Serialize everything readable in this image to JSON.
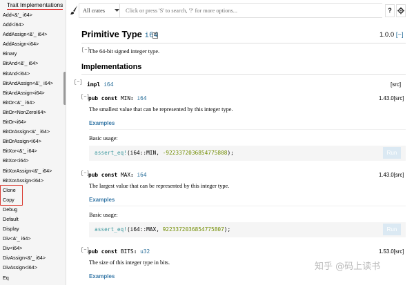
{
  "sidebar": {
    "title": "Trait Implementations",
    "items": [
      "Add<&'_ i64>",
      "Add<i64>",
      "AddAssign<&'_ i64>",
      "AddAssign<i64>",
      "Binary",
      "BitAnd<&'_ i64>",
      "BitAnd<i64>",
      "BitAndAssign<&'_ i64>",
      "BitAndAssign<i64>",
      "BitOr<&'_ i64>",
      "BitOr<NonZeroI64>",
      "BitOr<i64>",
      "BitOrAssign<&'_ i64>",
      "BitOrAssign<i64>",
      "BitXor<&'_ i64>",
      "BitXor<i64>",
      "BitXorAssign<&'_ i64>",
      "BitXorAssign<i64>",
      "Clone",
      "Copy",
      "Debug",
      "Default",
      "Display",
      "Div<&'_ i64>",
      "Div<i64>",
      "DivAssign<&'_ i64>",
      "DivAssign<i64>",
      "Eq"
    ]
  },
  "search": {
    "crate_select": "All crates",
    "placeholder": "Click or press 'S' to search, '?' for more options...",
    "help_label": "?"
  },
  "main": {
    "title_prefix": "Primitive Type",
    "title_type": "i64",
    "version": "1.0.0",
    "version_bracket": "[−]",
    "desc_toggle": "[−]",
    "description": "The 64-bit signed integer type.",
    "implementations_heading": "Implementations",
    "impl_toggle": "[−]",
    "impl_keyword": "impl",
    "impl_type": "i64",
    "impl_src": "[src]",
    "items": [
      {
        "toggle": "[−]",
        "sig_prefix": "pub const",
        "name": "MIN",
        "type": "i64",
        "version": "1.43.0[src]",
        "doc": "The smallest value that can be represented by this integer type.",
        "examples": "Examples",
        "basic": "Basic usage:",
        "code_macro": "assert_eq!",
        "code_mid": "(i64::MIN, ",
        "code_num": "-9223372036854775808",
        "code_end": ");",
        "run": "Run"
      },
      {
        "toggle": "[−]",
        "sig_prefix": "pub const",
        "name": "MAX",
        "type": "i64",
        "version": "1.43.0[src]",
        "doc": "The largest value that can be represented by this integer type.",
        "examples": "Examples",
        "basic": "Basic usage:",
        "code_macro": "assert_eq!",
        "code_mid": "(i64::MAX, ",
        "code_num": "9223372036854775807",
        "code_end": ");",
        "run": "Run"
      },
      {
        "toggle": "[−]",
        "sig_prefix": "pub const",
        "name": "BITS",
        "type": "u32",
        "version": "1.53.0[src]",
        "doc": "The size of this integer type in bits.",
        "examples": "Examples"
      }
    ]
  },
  "watermark": "知乎 @码上读书",
  "colors": {
    "link": "#2a6f9a",
    "highlight": "#d9382e",
    "number": "#718c00",
    "macro": "#3e999f"
  }
}
